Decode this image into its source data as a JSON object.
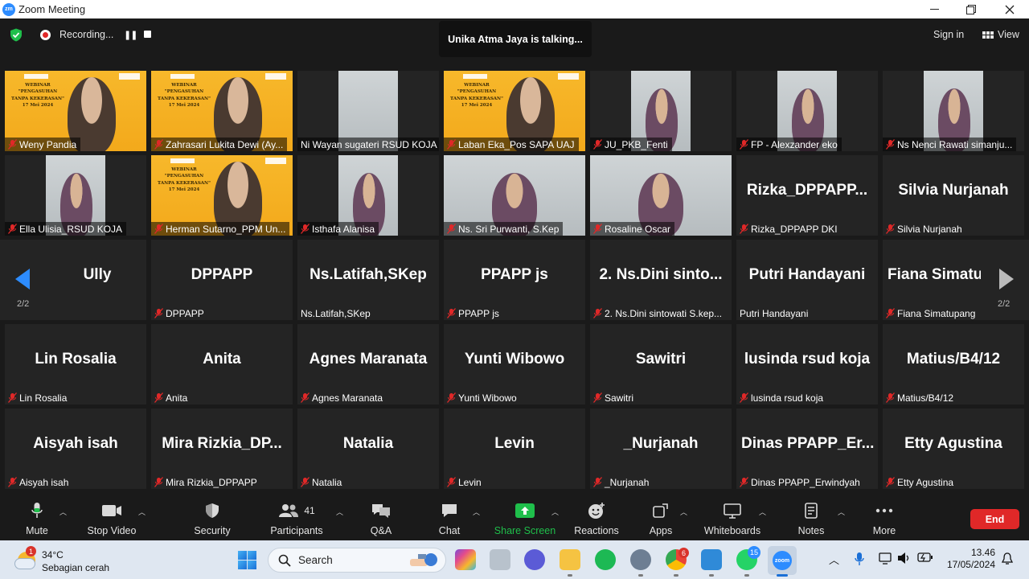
{
  "window": {
    "title": "Zoom Meeting",
    "app_icon_text": "zm",
    "controls": [
      "minimize",
      "maximize",
      "close"
    ]
  },
  "topbar": {
    "recording_label": "Recording...",
    "talking_label": "Unika Atma Jaya is talking...",
    "signin_label": "Sign in",
    "view_label": "View"
  },
  "banner": {
    "text": "WEBINAR \"PENGASUHAN TANPA KEKERASAN\" 17 Mei 2024"
  },
  "tiles": [
    {
      "name": "Weny Pandia",
      "video": "banner-person",
      "muted": true
    },
    {
      "name": "Zahrasari Lukita Dewi (Ay...",
      "video": "banner-person",
      "muted": true
    },
    {
      "name": "Ni Wayan sugateri RSUD KOJA",
      "video": "room",
      "muted": false
    },
    {
      "name": "Laban Eka_Pos SAPA UAJ",
      "video": "banner-person",
      "muted": true
    },
    {
      "name": "JU_PKB_Fenti",
      "video": "room-person",
      "muted": true
    },
    {
      "name": "FP - Alexzander eko",
      "video": "room-person",
      "muted": true
    },
    {
      "name": "Ns Nenci Rawati simanju...",
      "video": "room-person",
      "muted": true
    },
    {
      "name": "Ella Ulisia_RSUD KOJA",
      "video": "room-person",
      "muted": true
    },
    {
      "name": "Herman Sutarno_PPM Un...",
      "video": "banner-person",
      "muted": true
    },
    {
      "name": "Isthafa Alanisa",
      "video": "room-person",
      "muted": true
    },
    {
      "name": "Ns. Sri Purwanti, S.Kep",
      "video": "room-person",
      "muted": true
    },
    {
      "name": "Rosaline Oscar",
      "video": "room-person",
      "muted": true
    },
    {
      "name": "Rizka_DPPAPP DKI",
      "display": "Rizka_DPPAPP...",
      "muted": true
    },
    {
      "name": "Silvia Nurjanah",
      "display": "Silvia Nurjanah",
      "muted": true
    },
    {
      "name": "",
      "display": "Ully",
      "muted": true
    },
    {
      "name": "DPPAPP",
      "display": "DPPAPP",
      "muted": true
    },
    {
      "name": "Ns.Latifah,SKep",
      "display": "Ns.Latifah,SKep",
      "muted": false
    },
    {
      "name": "PPAPP js",
      "display": "PPAPP js",
      "muted": true
    },
    {
      "name": "2. Ns.Dini sintowati S.kep...",
      "display": "2. Ns.Dini sinto...",
      "muted": true
    },
    {
      "name": "Putri Handayani",
      "display": "Putri Handayani",
      "muted": false
    },
    {
      "name": "Fiana Simatupang",
      "display": "Fiana  Simatu",
      "muted": true
    },
    {
      "name": "Lin Rosalia",
      "display": "Lin Rosalia",
      "muted": true
    },
    {
      "name": "Anita",
      "display": "Anita",
      "muted": true
    },
    {
      "name": "Agnes Maranata",
      "display": "Agnes Maranata",
      "muted": true
    },
    {
      "name": "Yunti Wibowo",
      "display": "Yunti Wibowo",
      "muted": true
    },
    {
      "name": "Sawitri",
      "display": "Sawitri",
      "muted": true
    },
    {
      "name": "lusinda rsud koja",
      "display": "lusinda rsud koja",
      "muted": true
    },
    {
      "name": "Matius/B4/12",
      "display": "Matius/B4/12",
      "muted": true
    },
    {
      "name": "Aisyah isah",
      "display": "Aisyah isah",
      "muted": true
    },
    {
      "name": "Mira Rizkia_DPPAPP",
      "display": "Mira  Rizkia_DP...",
      "muted": true
    },
    {
      "name": "Natalia",
      "display": "Natalia",
      "muted": true
    },
    {
      "name": "Levin",
      "display": "Levin",
      "muted": true
    },
    {
      "name": "_Nurjanah",
      "display": "_Nurjanah",
      "muted": true
    },
    {
      "name": "Dinas PPAPP_Erwindyah",
      "display": "Dinas  PPAPP_Er...",
      "muted": true
    },
    {
      "name": "Etty Agustina",
      "display": "Etty Agustina",
      "muted": true
    }
  ],
  "pager": {
    "left": "2/2",
    "right": "2/2"
  },
  "toolbar": {
    "mute": "Mute",
    "stop_video": "Stop Video",
    "security": "Security",
    "participants": "Participants",
    "participants_count": "41",
    "qa": "Q&A",
    "chat": "Chat",
    "share_screen": "Share Screen",
    "reactions": "Reactions",
    "apps": "Apps",
    "whiteboards": "Whiteboards",
    "notes": "Notes",
    "more": "More",
    "end": "End"
  },
  "taskbar": {
    "weather_temp": "34°C",
    "weather_desc": "Sebagian cerah",
    "weather_badge": "1",
    "search_label": "Search",
    "chrome_badge": "6",
    "whatsapp_badge": "15",
    "time": "13.46",
    "date": "17/05/2024"
  },
  "colors": {
    "accent_blue": "#2d8cff",
    "share_green": "#1fbf4b",
    "end_red": "#e02828",
    "banner_orange": "#f5b022",
    "muted_red": "#e02828"
  }
}
